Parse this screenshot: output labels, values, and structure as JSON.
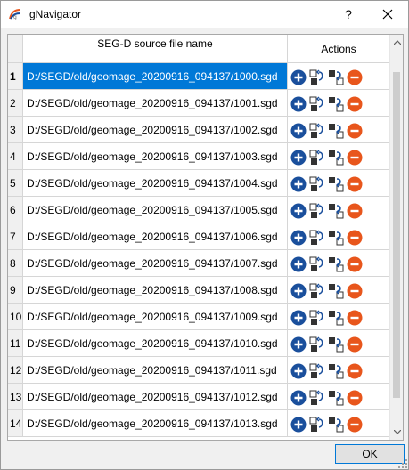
{
  "window": {
    "title": "gNavigator",
    "help_label": "?"
  },
  "table": {
    "columns": [
      "SEG-D source file name",
      "Actions"
    ],
    "rows": [
      {
        "num": "1",
        "file": "D:/SEGD/old/geomage_20200916_094137/1000.sgd",
        "selected": true
      },
      {
        "num": "2",
        "file": "D:/SEGD/old/geomage_20200916_094137/1001.sgd",
        "selected": false
      },
      {
        "num": "3",
        "file": "D:/SEGD/old/geomage_20200916_094137/1002.sgd",
        "selected": false
      },
      {
        "num": "4",
        "file": "D:/SEGD/old/geomage_20200916_094137/1003.sgd",
        "selected": false
      },
      {
        "num": "5",
        "file": "D:/SEGD/old/geomage_20200916_094137/1004.sgd",
        "selected": false
      },
      {
        "num": "6",
        "file": "D:/SEGD/old/geomage_20200916_094137/1005.sgd",
        "selected": false
      },
      {
        "num": "7",
        "file": "D:/SEGD/old/geomage_20200916_094137/1006.sgd",
        "selected": false
      },
      {
        "num": "8",
        "file": "D:/SEGD/old/geomage_20200916_094137/1007.sgd",
        "selected": false
      },
      {
        "num": "9",
        "file": "D:/SEGD/old/geomage_20200916_094137/1008.sgd",
        "selected": false
      },
      {
        "num": "10",
        "file": "D:/SEGD/old/geomage_20200916_094137/1009.sgd",
        "selected": false
      },
      {
        "num": "11",
        "file": "D:/SEGD/old/geomage_20200916_094137/1010.sgd",
        "selected": false
      },
      {
        "num": "12",
        "file": "D:/SEGD/old/geomage_20200916_094137/1011.sgd",
        "selected": false
      },
      {
        "num": "13",
        "file": "D:/SEGD/old/geomage_20200916_094137/1012.sgd",
        "selected": false
      },
      {
        "num": "14",
        "file": "D:/SEGD/old/geomage_20200916_094137/1013.sgd",
        "selected": false
      }
    ],
    "row_actions": [
      "add-icon",
      "replace-up-icon",
      "replace-down-icon",
      "remove-icon"
    ]
  },
  "footer": {
    "ok_label": "OK"
  },
  "colors": {
    "selection": "#0078d7",
    "add": "#1a4f9c",
    "remove": "#e8561c"
  }
}
